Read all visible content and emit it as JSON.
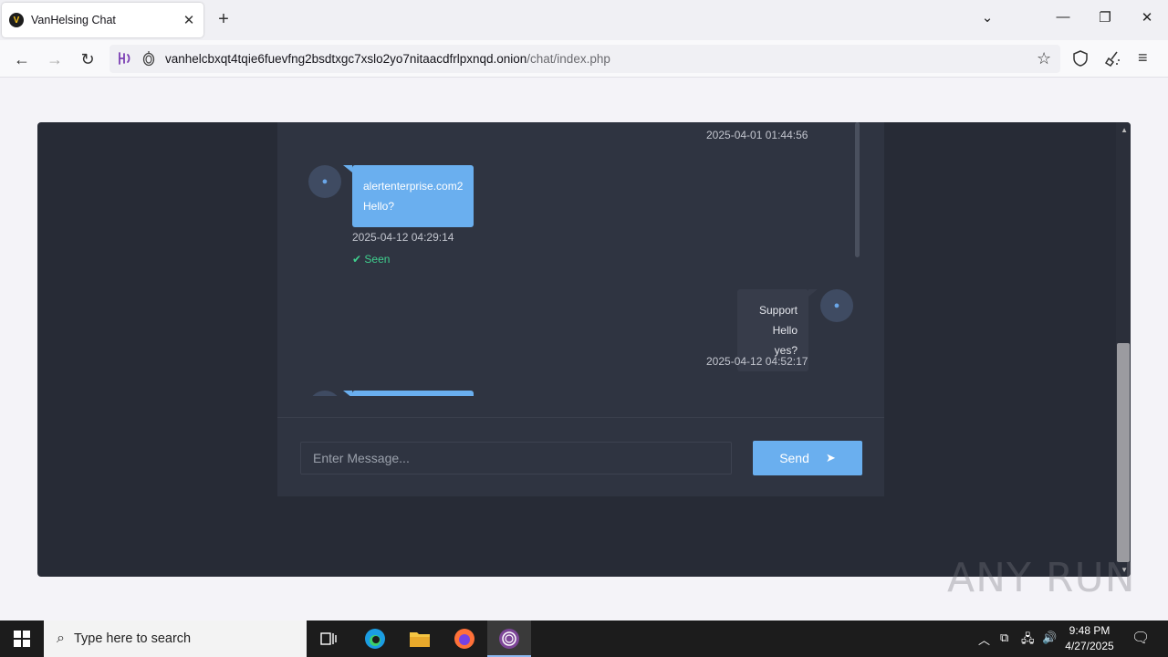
{
  "browser": {
    "tab_title": "VanHelsing Chat",
    "url_host": "vanhelcbxqt4tqie6fuevfng2bsdtxgc7xslo2yo7nitaacdfrlpxnqd.onion",
    "url_path": "/chat/index.php"
  },
  "chat": {
    "messages": [
      {
        "timestamp": "2025-04-01 01:44:56"
      },
      {
        "sender": "alertenterprise.com2",
        "text": "Hello?",
        "timestamp": "2025-04-12 04:29:14",
        "status": "✔ Seen"
      },
      {
        "sender": "Support",
        "text": "Hello yes?",
        "timestamp": "2025-04-12 04:52:17"
      }
    ],
    "input_placeholder": "Enter Message...",
    "send_label": "Send"
  },
  "watermark": "ANY RUN",
  "taskbar": {
    "search_placeholder": "Type here to search",
    "time": "9:48 PM",
    "date": "4/27/2025"
  },
  "colors": {
    "accent": "#6aafef",
    "panel": "#2f3441",
    "frame": "#272b36",
    "seen": "#3fcf8e"
  }
}
